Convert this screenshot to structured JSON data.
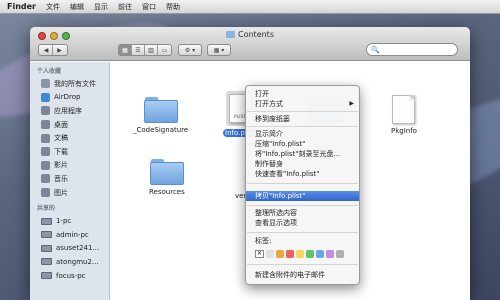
{
  "menubar": {
    "app": "Finder",
    "items": [
      "文件",
      "编辑",
      "显示",
      "前往",
      "窗口",
      "帮助"
    ]
  },
  "window": {
    "title": "Contents",
    "nav_back": "◀",
    "nav_forward": "▶",
    "view_modes": [
      "▦",
      "☰",
      "▥",
      "▭"
    ],
    "action_button": "⚙ ▾",
    "arrange_button": "▦ ▾",
    "search_placeholder": "🔍"
  },
  "sidebar": {
    "favorites_header": "个人收藏",
    "favorites": [
      {
        "label": "我的所有文件",
        "icon": "all-files-icon",
        "color": "#8a96a8"
      },
      {
        "label": "AirDrop",
        "icon": "airdrop-icon",
        "color": "#3c8ad8"
      },
      {
        "label": "应用程序",
        "icon": "applications-icon",
        "color": "#7b8796"
      },
      {
        "label": "桌面",
        "icon": "desktop-icon",
        "color": "#7b8796"
      },
      {
        "label": "文稿",
        "icon": "documents-icon",
        "color": "#7b8796"
      },
      {
        "label": "下载",
        "icon": "downloads-icon",
        "color": "#7b8796"
      },
      {
        "label": "影片",
        "icon": "movies-icon",
        "color": "#7b8796"
      },
      {
        "label": "音乐",
        "icon": "music-icon",
        "color": "#7b8796"
      },
      {
        "label": "图片",
        "icon": "pictures-icon",
        "color": "#7b8796"
      }
    ],
    "shared_header": "共享的",
    "shared": [
      {
        "label": "1-pc",
        "icon": "pc-icon"
      },
      {
        "label": "admin-pc",
        "icon": "pc-icon"
      },
      {
        "label": "asuset241...",
        "icon": "pc-icon"
      },
      {
        "label": "atongmu2...",
        "icon": "pc-icon"
      },
      {
        "label": "focus-pc",
        "icon": "pc-icon"
      }
    ]
  },
  "files": [
    {
      "label": "_CodeSignature",
      "kind": "folder"
    },
    {
      "label": "Info.plist",
      "kind": "plist",
      "selected": true
    },
    {
      "label": "PkgInfo",
      "kind": "doc"
    },
    {
      "label": "Resources",
      "kind": "folder"
    },
    {
      "label": "version.plist",
      "kind": "plist"
    }
  ],
  "context_menu": {
    "items": [
      {
        "label": "打开"
      },
      {
        "label": "打开方式",
        "submenu": true
      },
      {
        "label": "移到废纸篓"
      },
      {
        "label": "显示简介"
      },
      {
        "label": "压缩\"Info.plist\""
      },
      {
        "label": "将\"Info.plist\"刻录至光盘..."
      },
      {
        "label": "制作替身"
      },
      {
        "label": "快速查看\"Info.plist\""
      },
      {
        "label": "拷贝\"Info.plist\"",
        "highlighted": true
      },
      {
        "label": "整理所选内容"
      },
      {
        "label": "查看显示选项"
      },
      {
        "label": "标签:"
      },
      {
        "label": "新建含附件的电子邮件"
      }
    ],
    "submenu_arrow": "▶",
    "tag_clear": "✕",
    "tag_colors": [
      "#e0e0e0",
      "#f0a53a",
      "#f06262",
      "#f5d65a",
      "#67c267",
      "#6aa6ee",
      "#c58be0",
      "#b0b0b0"
    ]
  }
}
